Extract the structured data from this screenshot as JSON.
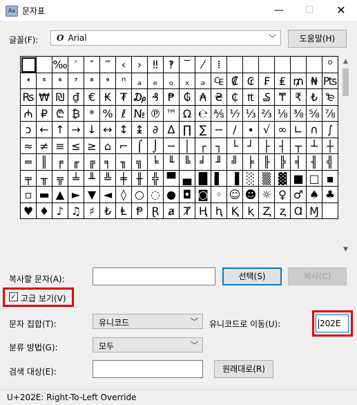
{
  "window": {
    "title": "문자표",
    "app_icon": "charmap-icon",
    "minimize_glyph": "—",
    "maximize_glyph": "☐",
    "close_glyph": "✕"
  },
  "font": {
    "label": "글꼴(F):",
    "icon_glyph": "O",
    "selected": "Arial",
    "help_button": "도움말(H)"
  },
  "grid": {
    "selected_index": 0,
    "rows": [
      [
        "",
        "",
        "‰",
        "′",
        "″",
        "‴",
        "‹",
        "›",
        "‼",
        "‽",
        "‾",
        "⁄",
        "⁞",
        "",
        "",
        "",
        "",
        "",
        "",
        "⁰"
      ],
      [
        "⁴",
        "⁵",
        "⁶",
        "⁷",
        "⁸",
        "⁹",
        "ⁿ",
        "ₐ",
        "ₑ",
        "ₒ",
        "ₓ",
        "ₔ",
        "₠",
        "₡",
        "₢",
        "₣",
        "₤",
        "₥",
        "₦",
        "₧"
      ],
      [
        "₨",
        "₩",
        "₪",
        "₫",
        "€",
        "₭",
        "₮",
        "₯",
        "₰",
        "₱",
        "₲",
        "₳",
        "₴",
        "₵",
        "₶",
        "₷",
        "₸",
        "₹",
        "₺",
        "₻"
      ],
      [
        "₼",
        "₽",
        "₾",
        "₿",
        "*",
        "%",
        "ℓ",
        "№",
        "℗",
        "™",
        "Ω",
        "℮",
        "⅍",
        "⅐",
        "⅓",
        "⅔",
        "⅛",
        "⅜",
        "⅝",
        "⅞"
      ],
      [
        "ↄ",
        "←",
        "↑",
        "→",
        "↓",
        "↔",
        "↕",
        "↨",
        "∂",
        "∆",
        "∏",
        "∑",
        "−",
        "∕",
        "∙",
        "√",
        "∞",
        "∟",
        "∩",
        "∫"
      ],
      [
        "≈",
        "≠",
        "≡",
        "≤",
        "≥",
        "⌂",
        "⌐",
        "⌠",
        "⌡",
        "─",
        "│",
        "┌",
        "┐",
        "└",
        "┘",
        "├",
        "┤",
        "┬",
        "┴",
        "┼"
      ],
      [
        "═",
        "║",
        "╒",
        "╓",
        "╔",
        "╕",
        "╖",
        "╗",
        "╘",
        "╙",
        "╚",
        "╛",
        "╜",
        "╝",
        "╞",
        "╟",
        "╠",
        "╡",
        "╢",
        "╣"
      ],
      [
        "╤",
        "╥",
        "╦",
        "╧",
        "╨",
        "╩",
        "╪",
        "╫",
        "╬",
        "▀",
        "▄",
        "█",
        "▌",
        "▐",
        "░",
        "▒",
        "▓",
        "■",
        "□",
        "▪"
      ],
      [
        "▫",
        "▬",
        "▲",
        "►",
        "▼",
        "◄",
        "◊",
        "○",
        "◌",
        "●",
        "◘",
        "◙",
        "◦",
        "☺",
        "☻",
        "☼",
        "♀",
        "♂",
        "♠",
        "♣"
      ],
      [
        "♥",
        "♦",
        "♪",
        "♫",
        "♯",
        "₺",
        "Ⱡ",
        "Ᵽ",
        "Ɽ",
        "ⱥ",
        "Ⱦ",
        "Ⱨ",
        "ⱨ",
        "Ⱪ",
        "ⱪ",
        "Ⱬ",
        "ⱬ",
        "Ɑ",
        "Ɱ",
        ""
      ]
    ]
  },
  "copy": {
    "label": "복사할 문자(A):",
    "value": "",
    "select_button": "선택(S)",
    "copy_button": "복사(C)"
  },
  "advanced": {
    "checkbox_label": "고급 보기(V)",
    "checked": true,
    "charset_label": "문자 집합(T):",
    "charset_value": "유니코드",
    "goto_label": "유니코드로 이동(U):",
    "goto_value": "202E",
    "groupby_label": "분류 방법(G):",
    "groupby_value": "모두",
    "search_label": "검색 대상(E):",
    "search_value": "",
    "search_button": "원래대로(R)"
  },
  "status": {
    "text": "U+202E: Right-To-Left Override"
  },
  "colors": {
    "highlight": "#e00000",
    "focus": "#0078d7"
  }
}
